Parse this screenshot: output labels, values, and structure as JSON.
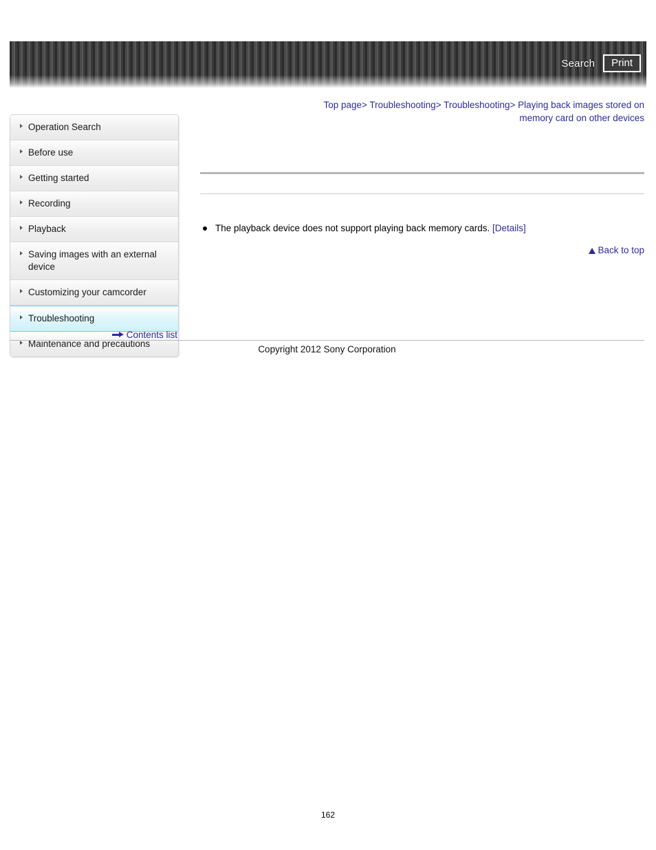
{
  "header": {
    "search_label": "Search",
    "print_label": "Print"
  },
  "breadcrumb": {
    "items": [
      "Top page",
      "Troubleshooting",
      "Troubleshooting",
      "Playing back images stored on memory card on other devices"
    ],
    "separator": ">"
  },
  "sidebar": {
    "items": [
      {
        "label": "Operation Search",
        "selected": false
      },
      {
        "label": "Before use",
        "selected": false
      },
      {
        "label": "Getting started",
        "selected": false
      },
      {
        "label": "Recording",
        "selected": false
      },
      {
        "label": "Playback",
        "selected": false
      },
      {
        "label": "Saving images with an external device",
        "selected": false
      },
      {
        "label": "Customizing your camcorder",
        "selected": false
      },
      {
        "label": "Troubleshooting",
        "selected": true
      },
      {
        "label": "Maintenance and precautions",
        "selected": false
      }
    ],
    "contents_list_label": "Contents list"
  },
  "main": {
    "heading": "",
    "subtitle": "",
    "bullets": [
      {
        "text": "The playback device does not support playing back memory cards.",
        "link_label": "[Details]"
      }
    ],
    "back_to_top_label": "Back to top"
  },
  "footer": {
    "copyright": "Copyright 2012 Sony Corporation",
    "page_number": "162"
  },
  "colors": {
    "link": "#2b2b9e",
    "selected_highlight": "#cdf1f8",
    "selected_border": "#5fd2ec",
    "header_stripe_dark": "#2b2b2b"
  }
}
